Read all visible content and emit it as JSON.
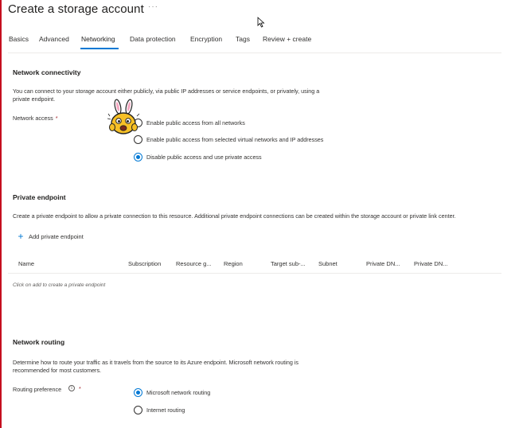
{
  "page": {
    "title": "Create a storage account",
    "more": "···"
  },
  "tabs": [
    {
      "label": "Basics"
    },
    {
      "label": "Advanced"
    },
    {
      "label": "Networking",
      "active": true
    },
    {
      "label": "Data protection"
    },
    {
      "label": "Encryption"
    },
    {
      "label": "Tags"
    },
    {
      "label": "Review + create"
    }
  ],
  "network_connectivity": {
    "title": "Network connectivity",
    "description_line1": "You can connect to your storage account either publicly, via public IP addresses or service endpoints, or privately, using a",
    "description_line2": "private endpoint.",
    "network_access_label": "Network access",
    "required_mark": "*",
    "options": [
      {
        "label": "Enable public access from all networks",
        "checked": false
      },
      {
        "label": "Enable public access from selected virtual networks and IP addresses",
        "checked": false
      },
      {
        "label": "Disable public access and use private access",
        "checked": true
      }
    ]
  },
  "private_endpoint": {
    "title": "Private endpoint",
    "description": "Create a private endpoint to allow a private connection to this resource. Additional private endpoint connections can be created within the storage account or private link center.",
    "add_label": "Add private endpoint",
    "columns": [
      "Name",
      "Subscription",
      "Resource g...",
      "Region",
      "Target sub-...",
      "Subnet",
      "Private DN...",
      "Private DN..."
    ],
    "empty_hint": "Click on add to create a private endpoint"
  },
  "network_routing": {
    "title": "Network routing",
    "description_line1": "Determine how to route your traffic as it travels from the source to its Azure endpoint. Microsoft network routing is",
    "description_line2": "recommended for most customers.",
    "routing_label": "Routing preference",
    "info_glyph": "i",
    "required_mark": "*",
    "options": [
      {
        "label": "Microsoft network routing",
        "checked": true
      },
      {
        "label": "Internet routing",
        "checked": false
      }
    ]
  },
  "colors": {
    "accent": "#0078d4",
    "left_edge": "#c50f1f",
    "sticker": "#f6c026"
  },
  "icons": {
    "add": "plus-icon",
    "info": "info-icon",
    "cursor": "mouse-pointer-icon",
    "sticker": "bunny-sticker-icon"
  }
}
